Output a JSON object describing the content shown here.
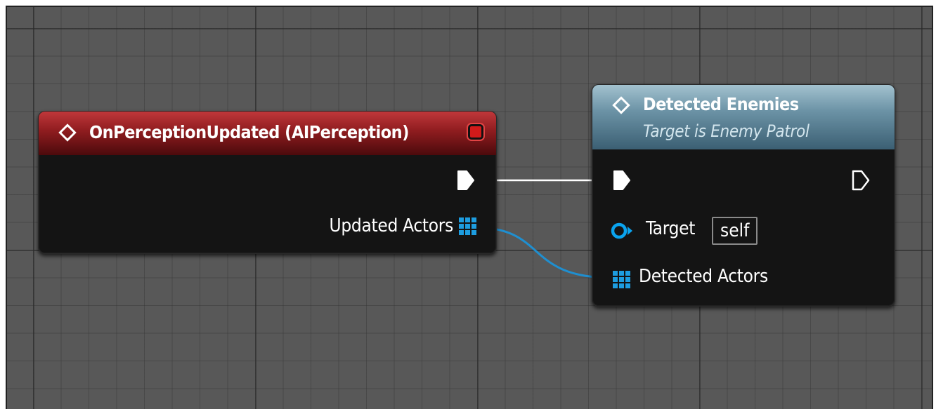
{
  "event_node": {
    "title": "OnPerceptionUpdated (AIPerception)",
    "output_pin_label": "Updated Actors",
    "header_color": "#a52326"
  },
  "call_node": {
    "title": "Detected Enemies",
    "subtitle": "Target is Enemy Patrol",
    "target_label": "Target",
    "target_default": "self",
    "detected_actors_label": "Detected Actors",
    "header_color": "#6c93a6"
  },
  "colors": {
    "exec_wire": "#ffffff",
    "array_wire": "#1f8fd0",
    "object_pin": "#0aa3ee",
    "array_pin": "#1d9de0"
  },
  "icons": {
    "node_icon": "diamond-icon",
    "event_stop": "stop-icon",
    "exec_pin": "exec-pin-icon",
    "array_pin": "array-pin-icon",
    "object_pin": "object-pin-icon"
  }
}
